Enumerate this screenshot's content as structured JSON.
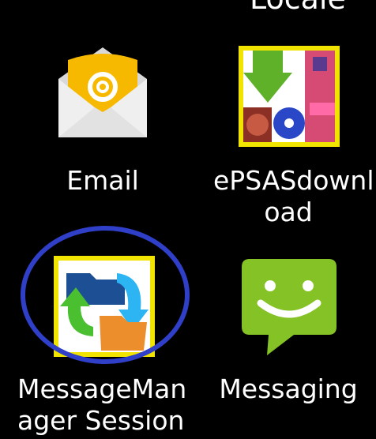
{
  "top_partial_label": "Locale",
  "apps": [
    {
      "label_lines": [
        "Email"
      ],
      "icon": "email-envelope-icon"
    },
    {
      "label_lines": [
        "ePSASdownl",
        "oad"
      ],
      "icon": "epsas-download-icon"
    },
    {
      "label_lines": [
        "MessageMan",
        "ager Session"
      ],
      "icon": "message-manager-session-icon"
    },
    {
      "label_lines": [
        "Messaging"
      ],
      "icon": "messaging-bubble-icon"
    }
  ],
  "colors": {
    "background": "#000000",
    "highlight_ring": "#2f3fc8",
    "icon_border": "#f1e400",
    "email_envelope": "#f3f3f3",
    "email_badge": "#f7b900",
    "messaging_bubble": "#84c225"
  }
}
